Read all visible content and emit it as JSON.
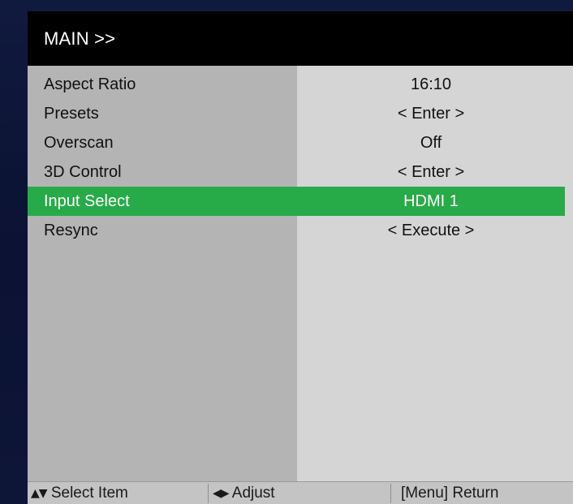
{
  "header": {
    "title": "MAIN >>"
  },
  "menu": {
    "items": [
      {
        "label": "Aspect Ratio",
        "value": "16:10",
        "selected": false
      },
      {
        "label": "Presets",
        "value": "< Enter >",
        "selected": false
      },
      {
        "label": "Overscan",
        "value": "Off",
        "selected": false
      },
      {
        "label": "3D Control",
        "value": "< Enter >",
        "selected": false
      },
      {
        "label": "Input Select",
        "value": "HDMI 1",
        "selected": true
      },
      {
        "label": "Resync",
        "value": "< Execute >",
        "selected": false
      }
    ]
  },
  "footer": {
    "select_glyph": "▲▼",
    "select_label": "Select Item",
    "adjust_glyph": "◀▶",
    "adjust_label": "Adjust",
    "return_label": "[Menu] Return"
  },
  "colors": {
    "selected_row": "#27ab48",
    "header_bg": "#000000",
    "label_column": "#b4b4b4",
    "value_column": "#d5d5d5"
  }
}
